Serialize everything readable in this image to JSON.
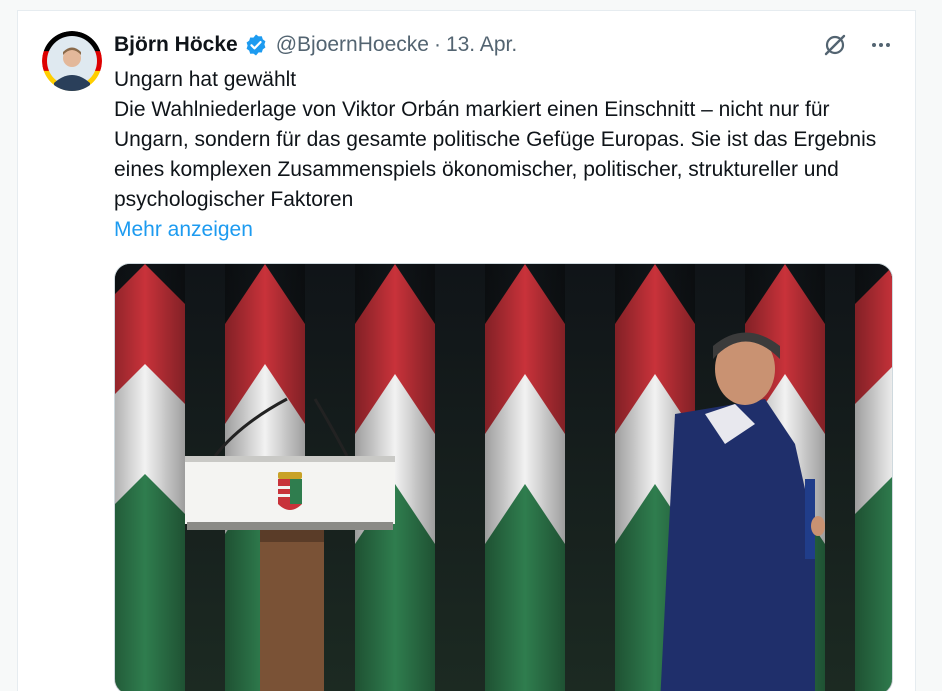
{
  "author": {
    "name": "Björn Höcke",
    "handle": "@BjoernHoecke",
    "separator": "·",
    "date": "13. Apr."
  },
  "icons": {
    "avatar": "avatar",
    "verified": "verified-badge-icon",
    "grok": "grok-icon",
    "more": "more-icon",
    "media": "photo-podium-flags"
  },
  "tweet": {
    "headline": "Ungarn hat gewählt",
    "text": "Die Wahlniederlage von Viktor Orbán markiert einen Einschnitt – nicht nur für Ungarn, sondern für das gesamte politische Gefüge Europas. Sie ist das Ergebnis eines komplexen Zusammenspiels ökonomischer, politischer, struktureller und psychologischer Faktoren",
    "show_more": "Mehr anzeigen"
  },
  "colors": {
    "link": "#1d9bf0",
    "verified": "#1d9bf0",
    "flag_red": "#c8323a",
    "flag_white": "#f2f2f2",
    "flag_green": "#2f7d4e"
  }
}
